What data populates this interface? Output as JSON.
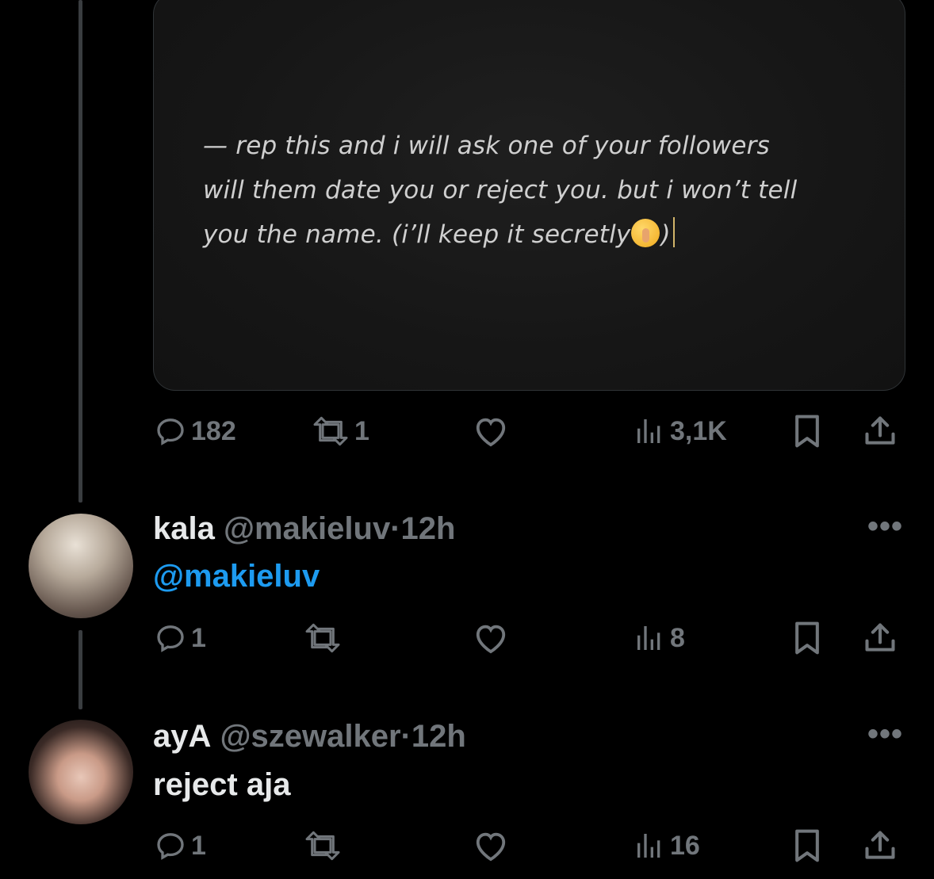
{
  "media_card": {
    "lines": [
      "— rep this and i will ask one of your followers",
      "will them date you or reject you. but i won’t tell",
      "you the name. (i’ll keep it secretly",
      ")"
    ],
    "emoji": "shushing-face-emoji"
  },
  "main_tweet_actions": {
    "replies": "182",
    "reposts": "1",
    "views": "3,1K"
  },
  "replies": [
    {
      "name": "kala",
      "handle": "@makieluv",
      "separator": "·",
      "time": "12h",
      "text": "@makieluv",
      "counts": {
        "replies": "1",
        "reposts": "",
        "views": "8"
      }
    },
    {
      "name": "ayA",
      "handle": "@szewalker",
      "separator": "·",
      "time": "12h",
      "text": "reject aja",
      "counts": {
        "replies": "1",
        "reposts": "",
        "views": "16"
      }
    }
  ],
  "more_label": "•••",
  "colors": {
    "muted": "#71767b",
    "link": "#1d9bf0",
    "text": "#e7e9ea",
    "background": "#000000"
  }
}
